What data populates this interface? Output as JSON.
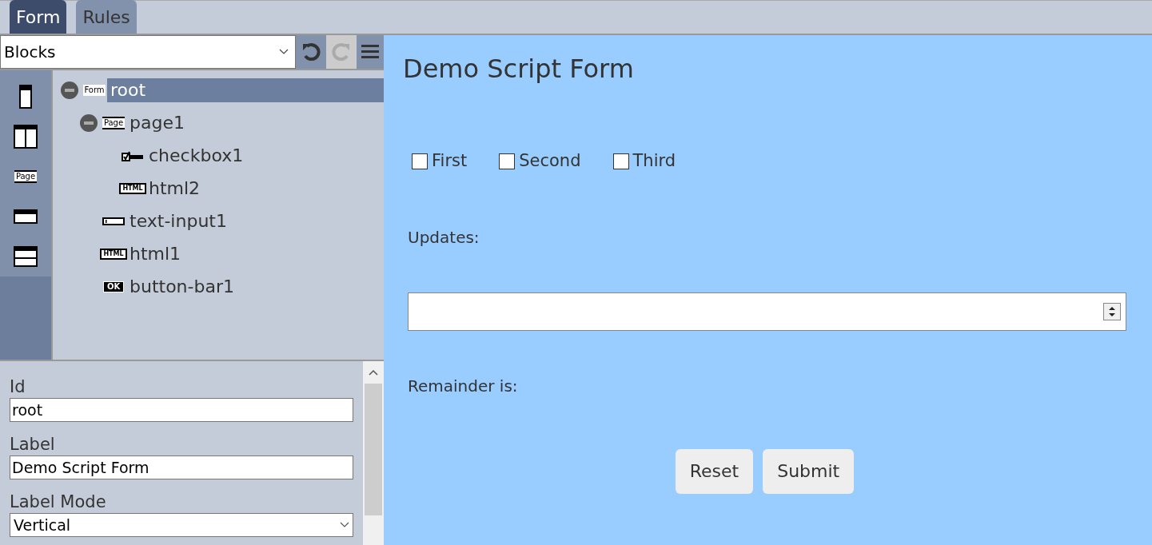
{
  "tabs": [
    {
      "label": "Form",
      "selected": true
    },
    {
      "label": "Rules",
      "selected": false
    }
  ],
  "toolbar": {
    "select_value": "Blocks",
    "undo": {
      "disabled": false
    },
    "redo": {
      "disabled": true
    }
  },
  "palette": [
    {
      "kind": "single"
    },
    {
      "kind": "columns"
    },
    {
      "kind": "page",
      "badge": "Page"
    },
    {
      "kind": "bar"
    },
    {
      "kind": "split"
    }
  ],
  "tree": [
    {
      "label": "root",
      "kind": "form",
      "badge": "Form",
      "collapsible": true,
      "selected": true,
      "children": [
        {
          "label": "page1",
          "kind": "page",
          "badge": "Page",
          "collapsible": true,
          "selected": false,
          "children": [
            {
              "label": "checkbox1",
              "kind": "checkbox",
              "collapsible": false,
              "selected": false
            },
            {
              "label": "html2",
              "kind": "html",
              "badge": "HTML",
              "collapsible": false,
              "selected": false
            }
          ]
        },
        {
          "label": "text-input1",
          "kind": "text-input",
          "collapsible": false,
          "selected": false
        },
        {
          "label": "html1",
          "kind": "html",
          "badge": "HTML",
          "collapsible": false,
          "selected": false
        },
        {
          "label": "button-bar1",
          "kind": "button-bar",
          "badge": "OK",
          "collapsible": false,
          "selected": false
        }
      ]
    }
  ],
  "properties": [
    {
      "label": "Id",
      "kind": "text",
      "value": "root"
    },
    {
      "label": "Label",
      "kind": "text",
      "value": "Demo Script Form"
    },
    {
      "label": "Label Mode",
      "kind": "select",
      "value": "Vertical"
    }
  ],
  "form": {
    "title": "Demo Script Form",
    "checkboxes": [
      {
        "label": "First",
        "checked": false
      },
      {
        "label": "Second",
        "checked": false
      },
      {
        "label": "Third",
        "checked": false
      }
    ],
    "updates_label": "Updates:",
    "remainder_label": "Remainder is:",
    "buttons": [
      "Reset",
      "Submit"
    ]
  }
}
